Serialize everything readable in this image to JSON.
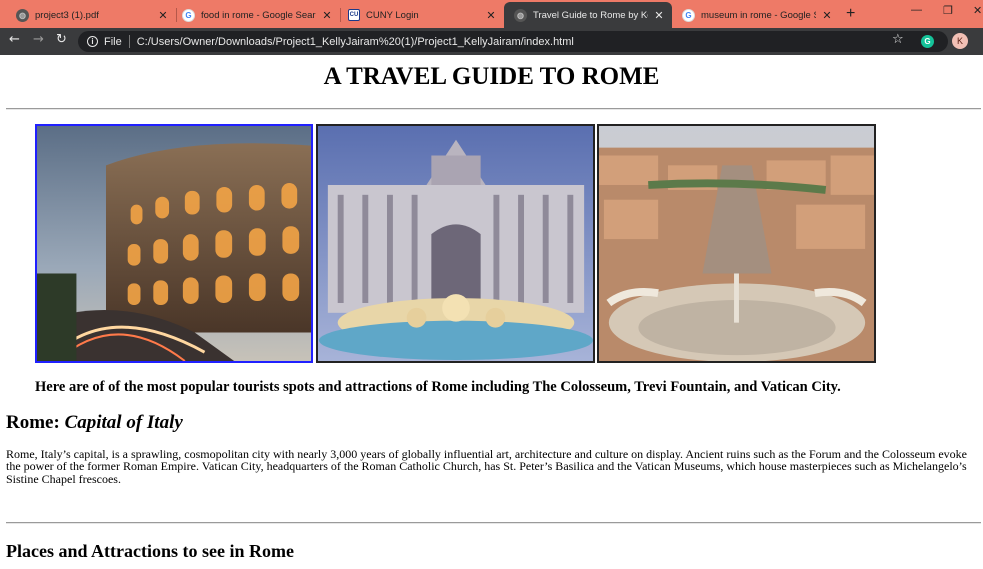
{
  "browser": {
    "tabs": [
      {
        "title": "project3 (1).pdf",
        "icon": "globe-icon"
      },
      {
        "title": "food in rome - Google Search",
        "icon": "google-icon"
      },
      {
        "title": "CUNY Login",
        "icon": "cuny-icon"
      },
      {
        "title": "Travel Guide to Rome by Kelly",
        "icon": "globe-icon",
        "active": true
      },
      {
        "title": "museum in rome - Google Sea",
        "icon": "google-icon"
      }
    ],
    "new_tab": "+",
    "address_scheme": "File",
    "address_url": "C:/Users/Owner/Downloads/Project1_KellyJairam%20(1)/Project1_KellyJairam/index.html",
    "avatar_initial": "K",
    "extension_label": "G",
    "colors": {
      "tabstrip": "#ee7a67",
      "toolbar": "#3a3b3d",
      "omnibox": "#202124"
    }
  },
  "page": {
    "title": "A TRAVEL GUIDE TO ROME",
    "photos": [
      {
        "subject": "Colosseum"
      },
      {
        "subject": "Trevi Fountain"
      },
      {
        "subject": "Vatican City"
      }
    ],
    "caption": "Here are of of the most popular tourists spots and attractions of Rome including The Colosseum, Trevi Fountain, and Vatican City.",
    "section1_heading": "Rome: ",
    "section1_heading_em": "Capital of Italy",
    "section1_body": "Rome, Italy’s capital, is a sprawling, cosmopolitan city with nearly 3,000 years of globally influential art, architecture and culture on display. Ancient ruins such as the Forum and the Colosseum evoke the power of the former Roman Empire. Vatican City, headquarters of the Roman Catholic Church, has St. Peter’s Basilica and the Vatican Museums, which house masterpieces such as Michelangelo’s Sistine Chapel frescoes.",
    "section2_heading": "Places and Attractions to see in Rome"
  }
}
